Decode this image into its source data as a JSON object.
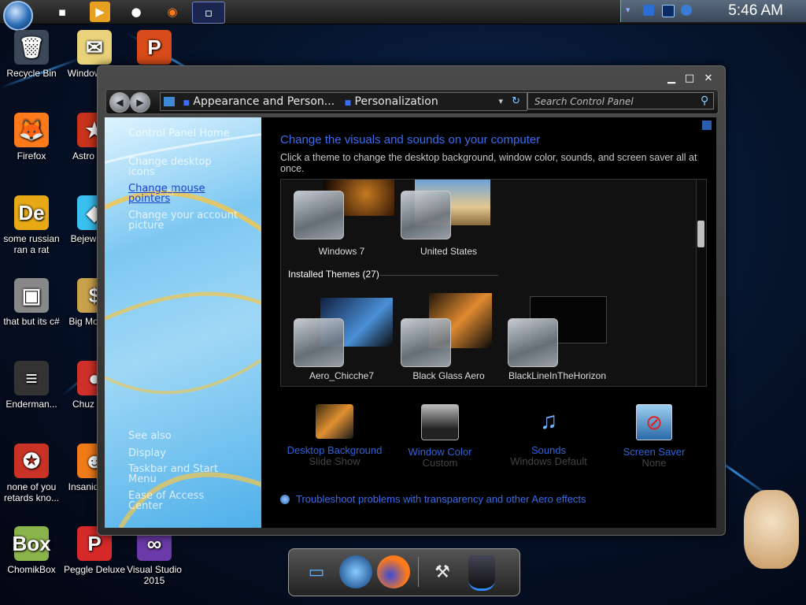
{
  "taskbar": {
    "clock": "5:46 AM",
    "buttons": [
      "app-icon",
      "media-player-icon",
      "globe-icon",
      "firefox-icon",
      "window-icon"
    ]
  },
  "desktop_icons": [
    {
      "label": "Recycle Bin",
      "glyph": "🗑",
      "col": 0,
      "row": 0
    },
    {
      "label": "Windows Ma",
      "glyph": "✉",
      "col": 1,
      "row": 0
    },
    {
      "label": "",
      "glyph": "P",
      "col": 2,
      "row": 0
    },
    {
      "label": "Firefox",
      "glyph": "🦊",
      "col": 0,
      "row": 1
    },
    {
      "label": "Astro Delu",
      "glyph": "★",
      "col": 1,
      "row": 1
    },
    {
      "label": "some russian ran a rat",
      "glyph": "De",
      "col": 0,
      "row": 2
    },
    {
      "label": "Bejew Delu",
      "glyph": "◆",
      "col": 1,
      "row": 2
    },
    {
      "label": "that but its c#",
      "glyph": "▣",
      "col": 0,
      "row": 3
    },
    {
      "label": "Big Mo Delu",
      "glyph": "$",
      "col": 1,
      "row": 3
    },
    {
      "label": "Enderman...",
      "glyph": "≡",
      "col": 0,
      "row": 4
    },
    {
      "label": "Chuz Delu",
      "glyph": "●",
      "col": 1,
      "row": 4
    },
    {
      "label": "none of you retards kno...",
      "glyph": "✪",
      "col": 0,
      "row": 5
    },
    {
      "label": "Insaniq Delu",
      "glyph": "☻",
      "col": 1,
      "row": 5
    },
    {
      "label": "ChomikBox",
      "glyph": "Box",
      "col": 0,
      "row": 6
    },
    {
      "label": "Peggle Deluxe",
      "glyph": "P",
      "col": 1,
      "row": 6
    },
    {
      "label": "Visual Studio 2015",
      "glyph": "∞",
      "col": 2,
      "row": 6
    }
  ],
  "window": {
    "breadcrumbs": [
      "Appearance and Person...",
      "Personalization"
    ],
    "search_placeholder": "Search Control Panel",
    "left_pane": {
      "home": "Control Panel Home",
      "links": [
        "Change desktop icons",
        "Change mouse pointers",
        "Change your account picture"
      ],
      "see_also": [
        "See also",
        "Display",
        "Taskbar and Start Menu",
        "Ease of Access Center"
      ]
    },
    "heading": "Change the visuals and sounds on your computer",
    "description": "Click a theme to change the desktop background, window color, sounds, and screen saver all at once.",
    "my_themes": [
      "Windows 7",
      "United States"
    ],
    "installed_header": "Installed Themes (27)",
    "installed_themes": [
      "Aero_Chicche7",
      "Black Glass Aero",
      "BlackLineInTheHorizon"
    ],
    "bottom_items": [
      {
        "label": "Desktop Background",
        "sub": "Slide Show"
      },
      {
        "label": "Window Color",
        "sub": "Custom"
      },
      {
        "label": "Sounds",
        "sub": "Windows Default"
      },
      {
        "label": "Screen Saver",
        "sub": "None"
      }
    ],
    "troubleshoot": "Troubleshoot problems with transparency and other Aero effects"
  },
  "dock": [
    "monitor-icon",
    "network-icon",
    "firefox-icon",
    "tools-icon",
    "trash-icon"
  ]
}
